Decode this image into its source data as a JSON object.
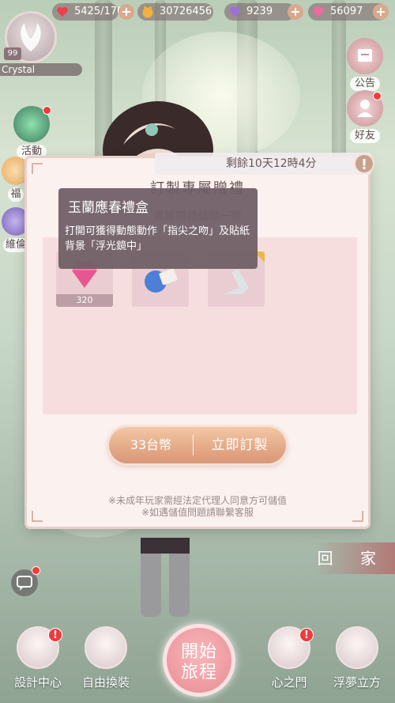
{
  "resources": [
    {
      "icon": "heart-icon",
      "value": "5425/170"
    },
    {
      "icon": "cat-coin-icon",
      "value": "30726456"
    },
    {
      "icon": "purple-diamond-icon",
      "value": "9239"
    },
    {
      "icon": "pink-diamond-icon",
      "value": "56097"
    }
  ],
  "player": {
    "level": "99",
    "name": "Crystal"
  },
  "side_left": {
    "event_label": "活動",
    "welfare_label": "福",
    "bond_label": "維倫"
  },
  "side_right": {
    "notice_label": "公告",
    "friends_label": "好友"
  },
  "dialog": {
    "timer": "剩餘10天12時4分",
    "title": "訂製專屬贈禮",
    "subtitle": "專屬贈禮獎勵一覽",
    "items": [
      {
        "icon": "pink-diamond-icon",
        "count": "320"
      },
      {
        "icon": "pose-action-icon",
        "count": ""
      },
      {
        "icon": "mirror-background-icon",
        "count": ""
      }
    ],
    "price": "33台幣",
    "action": "立即訂製",
    "notice1": "※未成年玩家需經法定代理人同意方可儲值",
    "notice2": "※如遇儲值問題請聯繫客服"
  },
  "tooltip": {
    "title": "玉蘭應春禮盒",
    "desc": "打開可獲得動態動作「指尖之吻」及貼紙背景「浮光鏡中」"
  },
  "home_label": "回 家",
  "bottom_nav": [
    {
      "label": "設計中心",
      "icon": "design-center-icon"
    },
    {
      "label": "自由換裝",
      "icon": "wardrobe-icon"
    },
    {
      "label": "心之門",
      "icon": "heart-gate-icon"
    },
    {
      "label": "浮夢立方",
      "icon": "dream-cube-icon"
    }
  ],
  "start": {
    "line1": "開始",
    "line2": "旅程"
  },
  "colors": {
    "accent": "#e3a986",
    "badge": "#ee3b3b",
    "dialog_bg": "#fbf1ef"
  }
}
